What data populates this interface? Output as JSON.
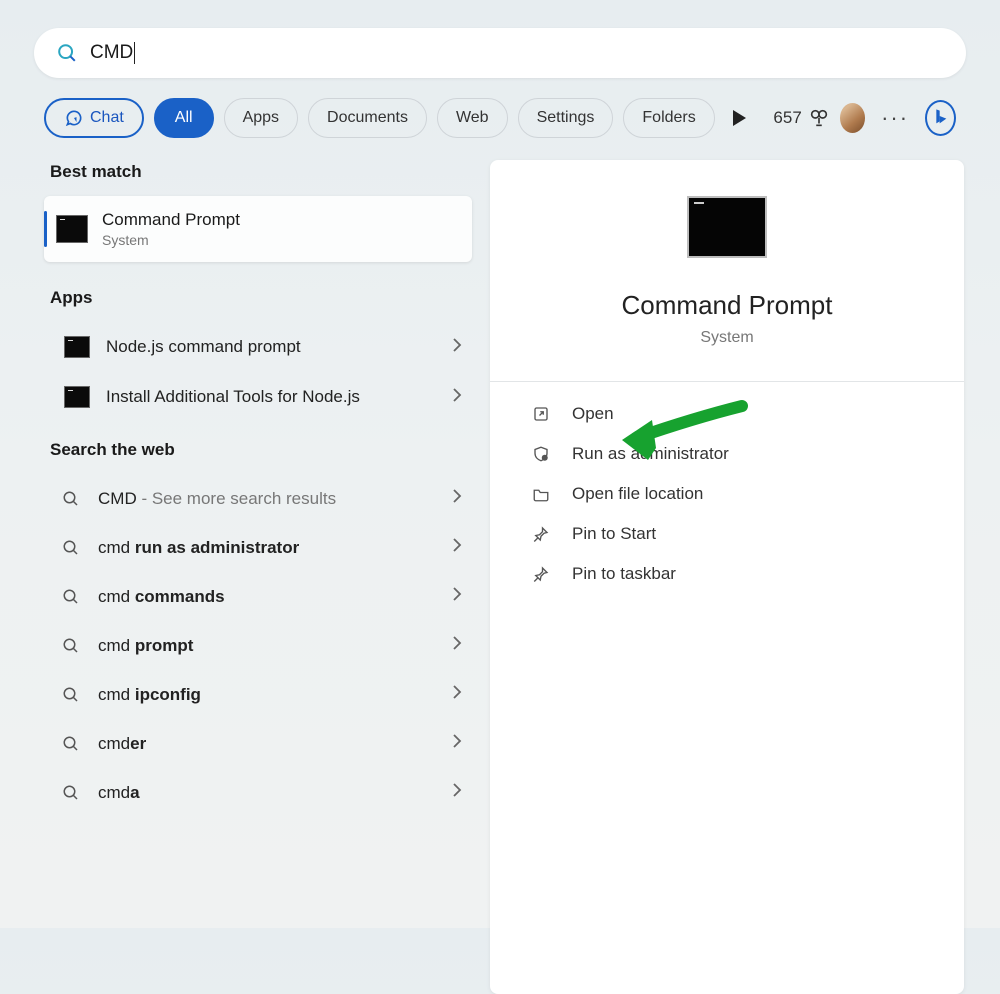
{
  "search": {
    "query": "CMD"
  },
  "chips": {
    "chat": "Chat",
    "all": "All",
    "apps": "Apps",
    "documents": "Documents",
    "web": "Web",
    "settings": "Settings",
    "folders": "Folders"
  },
  "points": {
    "value": "657"
  },
  "sections": {
    "best_match": "Best match",
    "apps": "Apps",
    "search_web": "Search the web"
  },
  "best_match": {
    "title": "Command Prompt",
    "subtitle": "System"
  },
  "apps_list": [
    {
      "label": "Node.js command prompt"
    },
    {
      "label": "Install Additional Tools for Node.js"
    }
  ],
  "web_list": [
    {
      "prefix": "CMD",
      "dash": " - ",
      "suffix": "See more search results"
    },
    {
      "prefix": "cmd ",
      "bold": "run as administrator"
    },
    {
      "prefix": "cmd ",
      "bold": "commands"
    },
    {
      "prefix": "cmd ",
      "bold": "prompt"
    },
    {
      "prefix": "cmd ",
      "bold": "ipconfig"
    },
    {
      "prefix": "cmd",
      "bold": "er"
    },
    {
      "prefix": "cmd",
      "bold": "a"
    }
  ],
  "detail": {
    "title": "Command Prompt",
    "subtitle": "System",
    "actions": {
      "open": "Open",
      "run_admin": "Run as administrator",
      "file_location": "Open file location",
      "pin_start": "Pin to Start",
      "pin_taskbar": "Pin to taskbar"
    }
  }
}
